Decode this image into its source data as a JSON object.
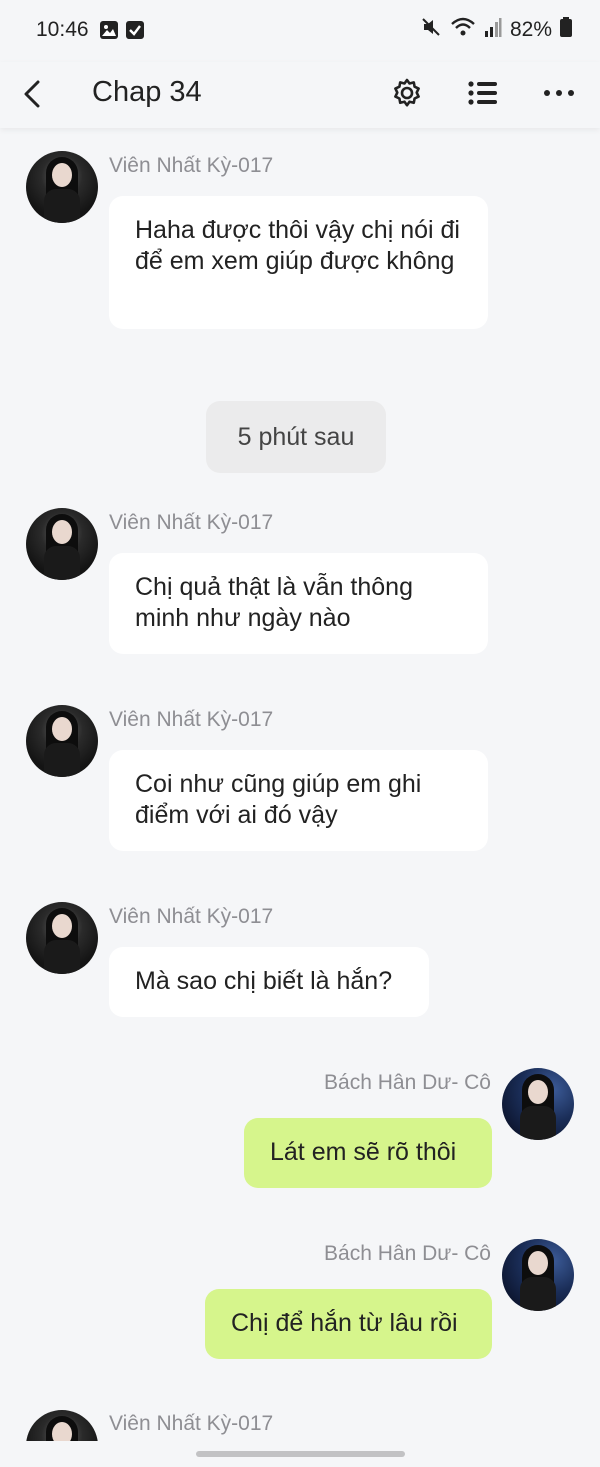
{
  "status_bar": {
    "time": "10:46",
    "battery": "82%",
    "icons": [
      "gallery-icon",
      "check-icon",
      "mute-icon",
      "wifi-icon",
      "signal-icon",
      "battery-icon"
    ]
  },
  "app_bar": {
    "title": "Chap 34",
    "icons": [
      "back-icon",
      "settings-icon",
      "list-icon",
      "more-icon"
    ]
  },
  "messages": [
    {
      "sender": "Viên Nhất Kỳ-017",
      "text": "Haha được thôi vậy chị nói đi để em xem giúp được không",
      "side": "left"
    },
    {
      "system": "5 phút sau"
    },
    {
      "sender": "Viên Nhất Kỳ-017",
      "text": "Chị quả thật là vẫn thông minh như ngày nào",
      "side": "left"
    },
    {
      "sender": "Viên Nhất Kỳ-017",
      "text": "Coi như cũng giúp em ghi điểm với ai đó vậy",
      "side": "left"
    },
    {
      "sender": "Viên Nhất Kỳ-017",
      "text": "Mà sao chị biết là hắn?",
      "side": "left"
    },
    {
      "sender": "Bách Hân Dư- Cô",
      "text": "Lát em sẽ rõ thôi",
      "side": "right"
    },
    {
      "sender": "Bách Hân Dư- Cô",
      "text": "Chị để hắn từ lâu rồi",
      "side": "right"
    },
    {
      "sender": "Viên Nhất Kỳ-017",
      "side": "left"
    }
  ],
  "colors": {
    "background": "#f5f6f8",
    "bubble_other": "#ffffff",
    "bubble_me": "#d6f58c",
    "sender_text": "#8e8e93"
  }
}
